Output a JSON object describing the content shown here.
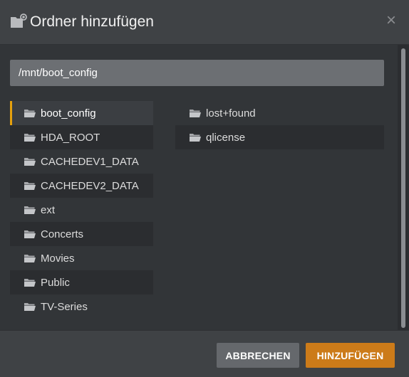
{
  "dialog": {
    "title": "Ordner hinzufügen",
    "close_glyph": "×",
    "title_icon": "folder-add-icon"
  },
  "path_input": {
    "value": "/mnt/boot_config"
  },
  "left_list": [
    {
      "label": "boot_config",
      "selected": true
    },
    {
      "label": "HDA_ROOT"
    },
    {
      "label": "CACHEDEV1_DATA"
    },
    {
      "label": "CACHEDEV2_DATA"
    },
    {
      "label": "ext"
    },
    {
      "label": "Concerts"
    },
    {
      "label": "Movies"
    },
    {
      "label": "Public"
    },
    {
      "label": "TV-Series"
    }
  ],
  "right_list": [
    {
      "label": "lost+found"
    },
    {
      "label": "qlicense"
    }
  ],
  "footer": {
    "cancel_label": "ABBRECHEN",
    "add_label": "HINZUFÜGEN"
  },
  "colors": {
    "accent": "#e5a00d",
    "primary_button": "#cc7b19",
    "secondary_button": "#65686c"
  }
}
